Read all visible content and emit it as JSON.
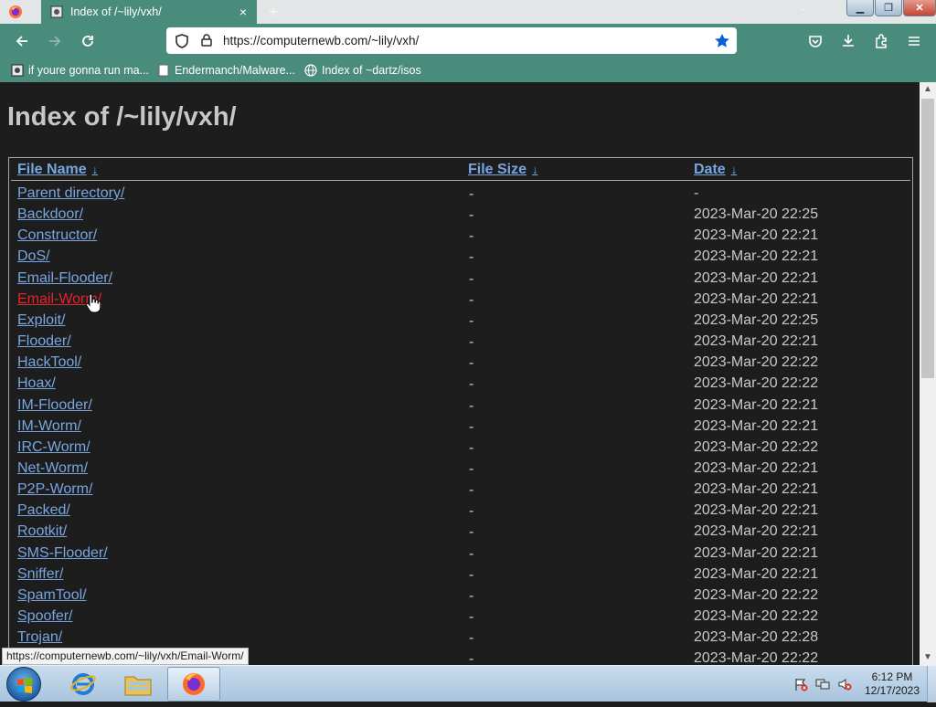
{
  "browser": {
    "tab": {
      "title": "Index of /~lily/vxh/",
      "close_glyph": "×"
    },
    "new_tab_glyph": "+",
    "window_buttons": {
      "min": "▁",
      "max": "❐",
      "close": "✕"
    },
    "url": "https://computernewb.com/~lily/vxh/",
    "bookmarks": [
      {
        "label": "if youre gonna run ma...",
        "icon": "cd-icon"
      },
      {
        "label": "Endermanch/Malware...",
        "icon": "page-icon"
      },
      {
        "label": "Index of ~dartz/isos",
        "icon": "globe-icon"
      }
    ],
    "status_link": "https://computernewb.com/~lily/vxh/Email-Worm/"
  },
  "page": {
    "title": "Index of /~lily/vxh/",
    "headers": {
      "name": "File Name",
      "size": "File Size",
      "date": "Date",
      "sort_glyph": "↓"
    },
    "rows": [
      {
        "name": "Parent directory/",
        "size": "-",
        "date": "-"
      },
      {
        "name": "Backdoor/",
        "size": "-",
        "date": "2023-Mar-20 22:25"
      },
      {
        "name": "Constructor/",
        "size": "-",
        "date": "2023-Mar-20 22:21"
      },
      {
        "name": "DoS/",
        "size": "-",
        "date": "2023-Mar-20 22:21"
      },
      {
        "name": "Email-Flooder/",
        "size": "-",
        "date": "2023-Mar-20 22:21"
      },
      {
        "name": "Email-Worm/",
        "size": "-",
        "date": "2023-Mar-20 22:21"
      },
      {
        "name": "Exploit/",
        "size": "-",
        "date": "2023-Mar-20 22:25"
      },
      {
        "name": "Flooder/",
        "size": "-",
        "date": "2023-Mar-20 22:21"
      },
      {
        "name": "HackTool/",
        "size": "-",
        "date": "2023-Mar-20 22:22"
      },
      {
        "name": "Hoax/",
        "size": "-",
        "date": "2023-Mar-20 22:22"
      },
      {
        "name": "IM-Flooder/",
        "size": "-",
        "date": "2023-Mar-20 22:21"
      },
      {
        "name": "IM-Worm/",
        "size": "-",
        "date": "2023-Mar-20 22:21"
      },
      {
        "name": "IRC-Worm/",
        "size": "-",
        "date": "2023-Mar-20 22:22"
      },
      {
        "name": "Net-Worm/",
        "size": "-",
        "date": "2023-Mar-20 22:21"
      },
      {
        "name": "P2P-Worm/",
        "size": "-",
        "date": "2023-Mar-20 22:21"
      },
      {
        "name": "Packed/",
        "size": "-",
        "date": "2023-Mar-20 22:21"
      },
      {
        "name": "Rootkit/",
        "size": "-",
        "date": "2023-Mar-20 22:21"
      },
      {
        "name": "SMS-Flooder/",
        "size": "-",
        "date": "2023-Mar-20 22:21"
      },
      {
        "name": "Sniffer/",
        "size": "-",
        "date": "2023-Mar-20 22:21"
      },
      {
        "name": "SpamTool/",
        "size": "-",
        "date": "2023-Mar-20 22:22"
      },
      {
        "name": "Spoofer/",
        "size": "-",
        "date": "2023-Mar-20 22:22"
      },
      {
        "name": "Trojan/",
        "size": "-",
        "date": "2023-Mar-20 22:28"
      },
      {
        "name": "",
        "size": "-",
        "date": "2023-Mar-20 22:22"
      }
    ],
    "hovered_row": "Email-Worm/"
  },
  "taskbar": {
    "time": "6:12 PM",
    "date": "12/17/2023",
    "items": [
      "internet-explorer-icon",
      "file-explorer-icon",
      "firefox-icon"
    ]
  },
  "colors": {
    "accent": "#4a8c7c",
    "link": "#78a6e0",
    "link_hover": "#e6222a",
    "page_bg": "#1d1d1d"
  }
}
